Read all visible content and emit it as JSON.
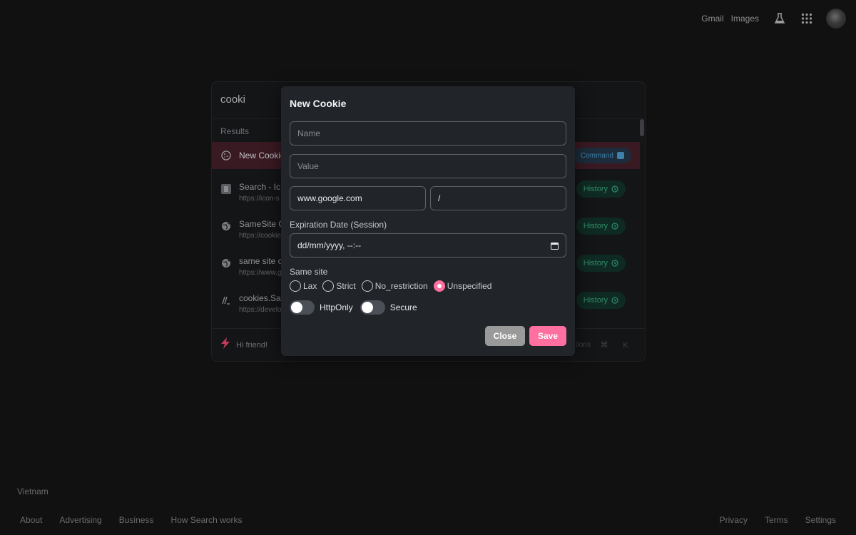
{
  "topbar": {
    "gmail": "Gmail",
    "images": "Images"
  },
  "footer": {
    "country": "Vietnam",
    "left_links": [
      "About",
      "Advertising",
      "Business",
      "How Search works"
    ],
    "right_links": [
      "Privacy",
      "Terms",
      "Settings"
    ]
  },
  "palette": {
    "query": "cooki",
    "results_label": "Results",
    "results": [
      {
        "title": "New Cookie",
        "url": "",
        "badge": "Command",
        "icon": "cookie-icon"
      },
      {
        "title": "Search - Ic",
        "url": "https://icon-s",
        "badge": "History",
        "icon": "page-icon"
      },
      {
        "title": "SameSite C",
        "url": "https://cookie",
        "badge": "History",
        "icon": "globe-icon"
      },
      {
        "title": "same site c",
        "url": "https://www.g",
        "badge": "History",
        "icon": "globe-icon"
      },
      {
        "title": "cookies.Sa",
        "url": "https://develo",
        "badge": "History",
        "icon": "mdn-icon"
      }
    ],
    "greeting": "Hi friend!",
    "actions_text": "tions"
  },
  "modal": {
    "title": "New Cookie",
    "name_placeholder": "Name",
    "value_placeholder": "Value",
    "domain_value": "www.google.com",
    "path_value": "/",
    "expiration_label": "Expiration Date (Session)",
    "date_value": "dd/mm/yyyy, --:--",
    "same_site_label": "Same site",
    "same_site_options": [
      "Lax",
      "Strict",
      "No_restriction",
      "Unspecified"
    ],
    "same_site_selected": "Unspecified",
    "http_only_label": "HttpOnly",
    "secure_label": "Secure",
    "close_label": "Close",
    "save_label": "Save"
  },
  "colors": {
    "accent": "#ff6f9f",
    "history_badge": "#2e8d6a",
    "command_badge": "#3f7fa8"
  }
}
